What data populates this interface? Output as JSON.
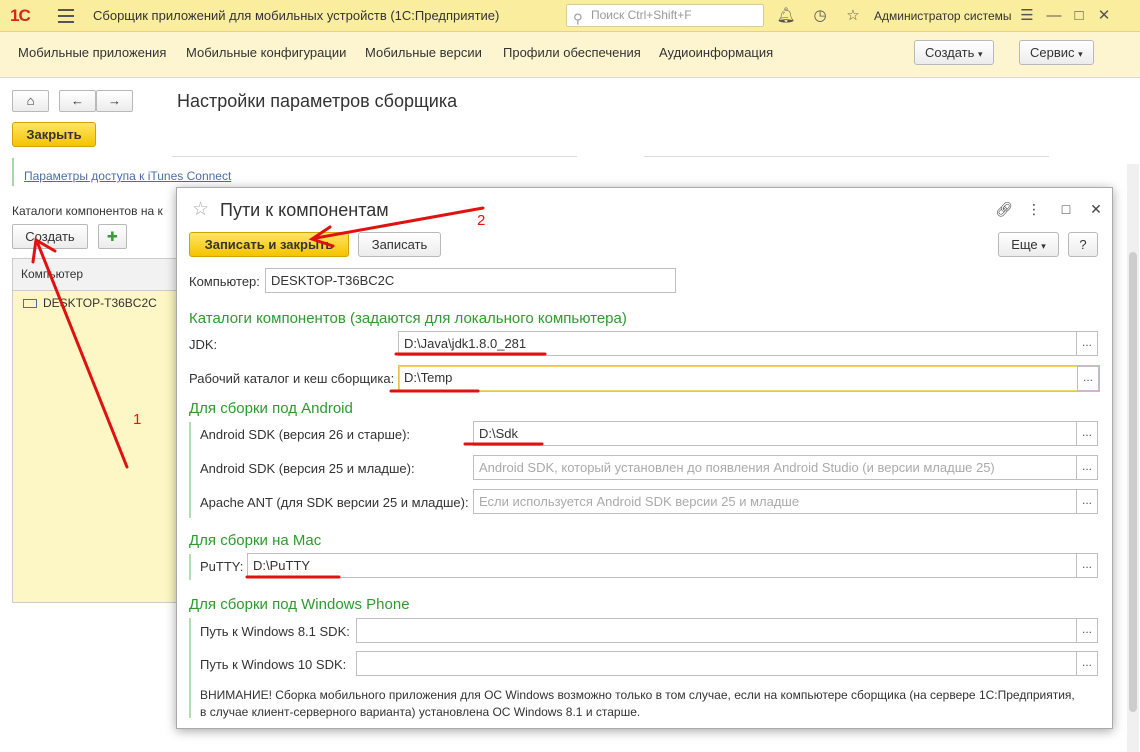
{
  "titlebar": {
    "logo": "1С",
    "app_title": "Сборщик приложений для мобильных устройств (1С:Предприятие)",
    "search_placeholder": "Поиск Ctrl+Shift+F",
    "user": "Администратор системы"
  },
  "nav": {
    "links": [
      "Мобильные приложения",
      "Мобильные конфигурации",
      "Мобильные версии",
      "Профили обеспечения",
      "Аудиоинформация"
    ],
    "create_label": "Создать",
    "service_label": "Сервис"
  },
  "background_form": {
    "title": "Настройки параметров сборщика",
    "close_label": "Закрыть",
    "itunes_link": "Параметры доступа к iTunes Connect",
    "catalog_label": "Каталоги компонентов на к",
    "create_label": "Создать",
    "list_header": "Компьютер",
    "list_rows": [
      "DESKTOP-T36BC2C"
    ]
  },
  "modal": {
    "title": "Пути к компонентам",
    "save_close_label": "Записать и закрыть",
    "save_label": "Записать",
    "more_label": "Еще",
    "help_label": "?",
    "computer_label": "Компьютер:",
    "computer_value": "DESKTOP-T36BC2C",
    "section_local": "Каталоги компонентов (задаются для локального компьютера)",
    "jdk_label": "JDK:",
    "jdk_value": "D:\\Java\\jdk1.8.0_281",
    "workdir_label": "Рабочий каталог и кеш сборщика:",
    "workdir_value": "D:\\Temp",
    "section_android": "Для сборки под Android",
    "sdk26_label": "Android SDK (версия 26 и старше):",
    "sdk26_value": "D:\\Sdk",
    "sdk25_label": "Android SDK (версия 25 и младше):",
    "sdk25_placeholder": "Android SDK, который установлен до появления Android Studio (и версии младше 25)",
    "ant_label": "Apache ANT (для SDK версии 25 и младше):",
    "ant_placeholder": "Если используется Android SDK версии 25 и младше",
    "section_mac": "Для сборки на Mac",
    "putty_label": "PuTTY:",
    "putty_value": "D:\\PuTTY",
    "section_wp": "Для сборки под Windows Phone",
    "win81_label": "Путь к Windows 8.1 SDK:",
    "win81_value": "",
    "win10_label": "Путь к Windows 10 SDK:",
    "win10_value": "",
    "warning": "ВНИМАНИЕ! Сборка мобильного приложения для ОС Windows возможно только в том случае, если на компьютере сборщика (на сервере 1С:Предприятия, в случае клиент-серверного варианта) установлена ОС Windows 8.1 и старше.",
    "dots": "..."
  },
  "annotations": {
    "num1": "1",
    "num2": "2"
  },
  "colors": {
    "header_bg": "#fbed9e",
    "nav_bg": "#fcf5cf",
    "accent_yellow": "#f4c400",
    "section_green": "#2f9a2f",
    "annotation_red": "#e11111"
  }
}
